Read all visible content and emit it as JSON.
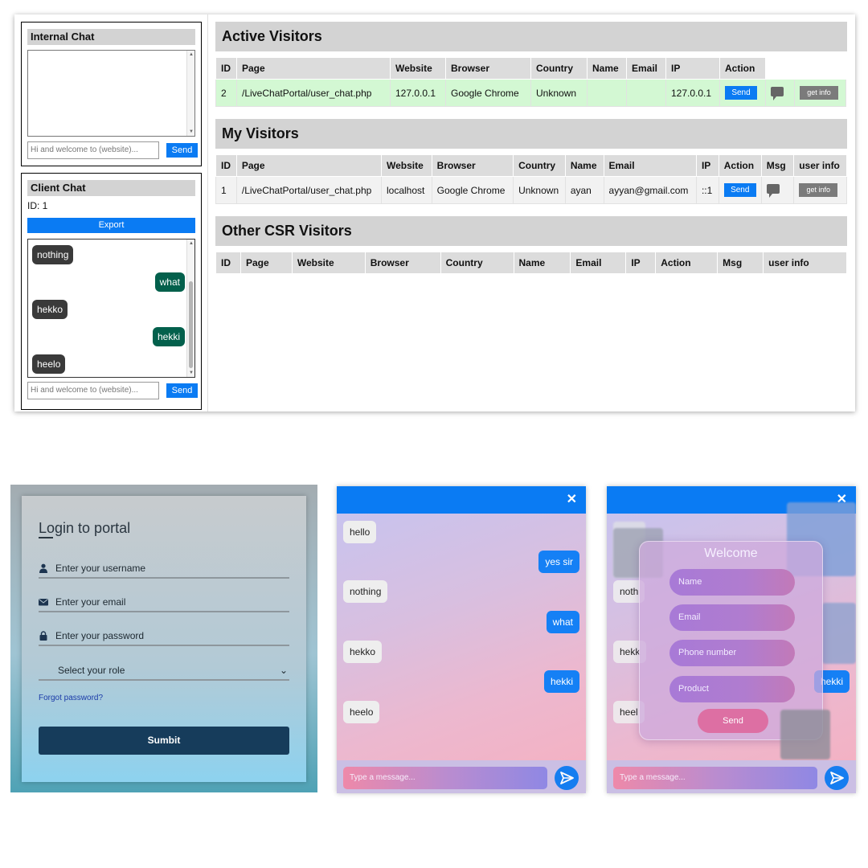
{
  "dashboard": {
    "internal_chat": {
      "title": "Internal Chat",
      "input_placeholder": "Hi and welcome to (website)...",
      "send_label": "Send"
    },
    "client_chat": {
      "title": "Client Chat",
      "id_label": "ID: 1",
      "export_label": "Export",
      "messages": [
        {
          "text": "nothing",
          "side": "left"
        },
        {
          "text": "what",
          "side": "right"
        },
        {
          "text": "hekko",
          "side": "left"
        },
        {
          "text": "hekki",
          "side": "right"
        },
        {
          "text": "heelo",
          "side": "left"
        }
      ],
      "input_placeholder": "Hi and welcome to (website)...",
      "send_label": "Send"
    },
    "active_visitors": {
      "title": "Active Visitors",
      "columns": [
        "ID",
        "Page",
        "Website",
        "Browser",
        "Country",
        "Name",
        "Email",
        "IP",
        "Action"
      ],
      "rows": [
        {
          "id": "2",
          "page": "/LiveChatPortal/user_chat.php",
          "website": "127.0.0.1",
          "browser": "Google Chrome",
          "country": "Unknown",
          "name": "",
          "email": "",
          "ip": "127.0.0.1",
          "send": "Send",
          "get_info": "get info"
        }
      ]
    },
    "my_visitors": {
      "title": "My Visitors",
      "columns": [
        "ID",
        "Page",
        "Website",
        "Browser",
        "Country",
        "Name",
        "Email",
        "IP",
        "Action",
        "Msg",
        "user info"
      ],
      "rows": [
        {
          "id": "1",
          "page": "/LiveChatPortal/user_chat.php",
          "website": "localhost",
          "browser": "Google Chrome",
          "country": "Unknown",
          "name": "ayan",
          "email": "ayyan@gmail.com",
          "ip": "::1",
          "send": "Send",
          "get_info": "get info"
        }
      ]
    },
    "other_csr": {
      "title": "Other CSR Visitors",
      "columns": [
        "ID",
        "Page",
        "Website",
        "Browser",
        "Country",
        "Name",
        "Email",
        "IP",
        "Action",
        "Msg",
        "user info"
      ]
    }
  },
  "login": {
    "title": "Login to portal",
    "username_placeholder": "Enter your username",
    "email_placeholder": "Enter your email",
    "password_placeholder": "Enter your password",
    "role_select": "Select your role",
    "forgot": "Forgot password?",
    "submit": "Sumbit"
  },
  "chat_widget": {
    "close": "✕",
    "messages": [
      {
        "text": "hello",
        "side": "in"
      },
      {
        "text": "yes sir",
        "side": "out"
      },
      {
        "text": "nothing",
        "side": "in"
      },
      {
        "text": "what",
        "side": "out"
      },
      {
        "text": "hekko",
        "side": "in"
      },
      {
        "text": "hekki",
        "side": "out"
      },
      {
        "text": "heelo",
        "side": "in"
      }
    ],
    "input_placeholder": "Type a message..."
  },
  "welcome_widget": {
    "close": "✕",
    "partial_messages": [
      "noth",
      "hekk",
      "hekki",
      "heel"
    ],
    "modal_title": "Welcome",
    "name_placeholder": "Name",
    "email_placeholder": "Email",
    "phone_placeholder": "Phone number",
    "product_placeholder": "Product",
    "send_label": "Send",
    "input_placeholder": "Type a message..."
  },
  "colors": {
    "primary_blue": "#0a7bf3",
    "active_row": "#d3f8d3",
    "header_gray": "#d3d3d3",
    "submit_navy": "#163c5b",
    "chat_green": "#03604c"
  }
}
